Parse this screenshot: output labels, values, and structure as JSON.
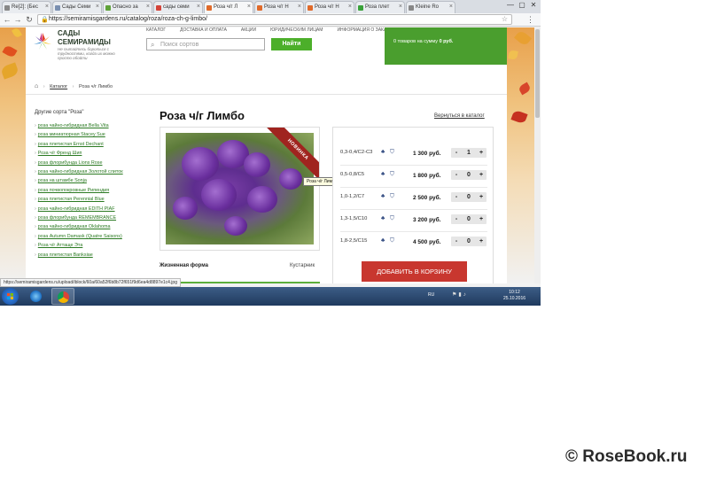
{
  "browser": {
    "tabs": [
      {
        "label": "Re[2]: (Бес",
        "color": "#888888"
      },
      {
        "label": "Сады Семи",
        "color": "#7a8fb0"
      },
      {
        "label": "Опасно за",
        "color": "#5fa23a"
      },
      {
        "label": "сады семи",
        "color": "#d4443a"
      },
      {
        "label": "Роза ч/г Л",
        "color": "#e06a2a"
      },
      {
        "label": "Роза ч/г Н",
        "color": "#e06a2a"
      },
      {
        "label": "Роза ч/г Н",
        "color": "#e06a2a"
      },
      {
        "label": "Роза плет",
        "color": "#3aa23a"
      },
      {
        "label": "Kleine Ro",
        "color": "#888888"
      }
    ],
    "active_tab": 4,
    "window_controls": [
      "—",
      "▢",
      "✕"
    ],
    "url": "https://semiramisgardens.ru/catalog/roza/roza-ch-g-limbo/"
  },
  "site": {
    "brand_line1": "САДЫ",
    "brand_line2": "СЕМИРАМИДЫ",
    "tagline": "Не пытайтесь бороться с трудностями, когда их можно просто обойти",
    "nav": [
      "КАТАЛОГ",
      "ДОСТАВКА И ОПЛАТА",
      "АКЦИИ",
      "ЮРИДИЧЕСКИМ ЛИЦАМ",
      "ИНФОРМАЦИЯ О ЗАКАЗЕ"
    ],
    "search_placeholder": "Поиск сортов",
    "search_button": "Найти",
    "cart_prefix": "0 товаров на сумму",
    "cart_sum": "0 руб."
  },
  "breadcrumb": {
    "catalog": "Каталог",
    "current": "Роза ч/г Лимбо"
  },
  "sidebar": {
    "title": "Другие сорта \"Роза\"",
    "items": [
      "роза чайно-гибридная Bella Vita",
      "роза миниатюрная Stacey Sue",
      "роза плетистая Ernst Dechant",
      "Роза ч/г Френд Шип",
      "роза флорибунда Lions Rose",
      "роза чайно-гибридная Золотой слиток",
      "роза на штамбе Sonja",
      "роза почвопокровные Рипендия",
      "роза плетистая Perennial Blue",
      "роза чайно-гибридная EDITH PIAF",
      "роза флорибунда REMEMBRANCE",
      "роза чайно-гибридная Oklahoma",
      "роза Autumn Damask (Quatre Saisons)",
      "Роза ч/г Аттаще Эта",
      "роза плетистая Banksiae"
    ]
  },
  "product": {
    "title": "Роза ч/г Лимбо",
    "back_link": "Вернуться в каталог",
    "badge": "НОВИНКА",
    "tooltip": "Роза ч/г Лимбо",
    "lifeform_label": "Жизненная форма",
    "lifeform_value": "Кустарник",
    "add_to_cart": "ДОБАВИТЬ В КОРЗИНУ",
    "variants": [
      {
        "size": "0,3-0,4/С2-С3",
        "price": "1 300 руб.",
        "qty": "1"
      },
      {
        "size": "0,5-0,8/С5",
        "price": "1 800 руб.",
        "qty": "0"
      },
      {
        "size": "1,0-1,2/С7",
        "price": "2 500 руб.",
        "qty": "0"
      },
      {
        "size": "1,3-1,5/С10",
        "price": "3 200 руб.",
        "qty": "0"
      },
      {
        "size": "1,8-2,5/С15",
        "price": "4 500 руб.",
        "qty": "0"
      }
    ],
    "stepper_minus": "-",
    "stepper_plus": "+"
  },
  "status_url": "https://semiramisgardens.ru/upload/iblock/60a/60a52f6b8b72f651f9d6ea4d8897e1c4.jpg",
  "taskbar": {
    "lang": "RU",
    "time": "10:12",
    "date": "25.10.2016"
  },
  "watermark": "© RoseBook.ru"
}
